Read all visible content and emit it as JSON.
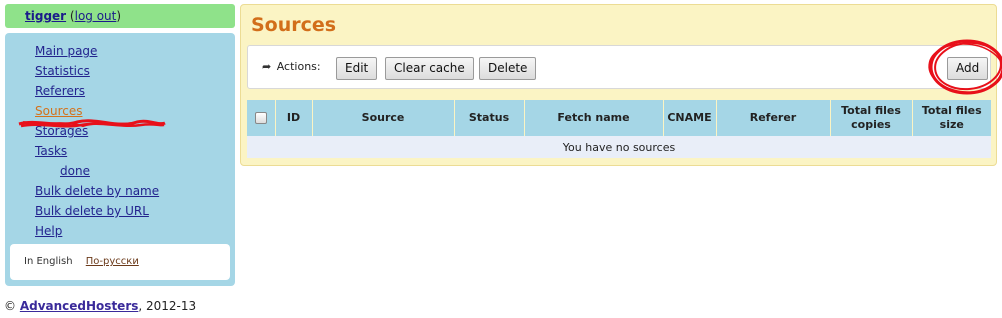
{
  "user": {
    "name": "tigger",
    "logout": "log out",
    "open_paren": "(",
    "close_paren": ")"
  },
  "sidebar": {
    "items": [
      {
        "label": "Main page"
      },
      {
        "label": "Statistics"
      },
      {
        "label": "Referers"
      },
      {
        "label": "Sources",
        "active": true
      },
      {
        "label": "Storages"
      },
      {
        "label": "Tasks"
      },
      {
        "label": "done",
        "sub": true
      },
      {
        "label": "Bulk delete by name"
      },
      {
        "label": "Bulk delete by URL"
      },
      {
        "label": "Help"
      }
    ],
    "lang": {
      "current": "In English",
      "other": "По-русски"
    }
  },
  "footer": {
    "copyright": "©",
    "link": "AdvancedHosters",
    "years": ", 2012-13"
  },
  "main": {
    "title": "Sources",
    "actions_label": "Actions:",
    "buttons": {
      "edit": "Edit",
      "clear_cache": "Clear cache",
      "delete": "Delete",
      "add": "Add"
    },
    "table": {
      "columns": [
        "ID",
        "Source",
        "Status",
        "Fetch name",
        "CNAME",
        "Referer",
        "Total files copies",
        "Total files size"
      ],
      "empty_message": "You have no sources"
    }
  },
  "colors": {
    "accent_orange": "#d26e1a",
    "sidebar_blue": "#a5d6e6",
    "user_green": "#8fe28a",
    "panel_yellow": "#fbf4c4",
    "annotation_red": "#e8101a"
  },
  "icons": {
    "actions": "share-arrow-icon"
  }
}
